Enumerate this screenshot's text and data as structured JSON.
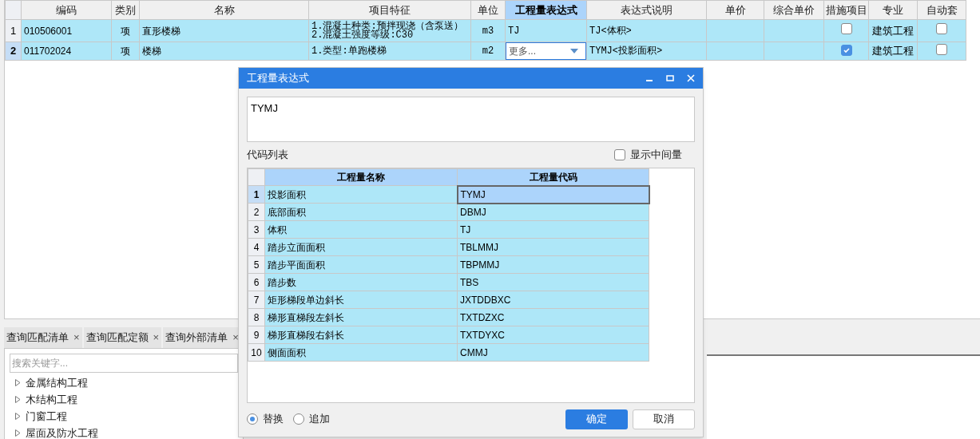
{
  "table": {
    "columns": [
      {
        "label": "编码",
        "selected": false
      },
      {
        "label": "类别",
        "selected": false
      },
      {
        "label": "名称",
        "selected": false
      },
      {
        "label": "项目特征",
        "selected": false
      },
      {
        "label": "单位",
        "selected": false
      },
      {
        "label": "工程量表达式",
        "selected": true
      },
      {
        "label": "表达式说明",
        "selected": false
      },
      {
        "label": "单价",
        "selected": false
      },
      {
        "label": "综合单价",
        "selected": false
      },
      {
        "label": "措施项目",
        "selected": false
      },
      {
        "label": "专业",
        "selected": false
      },
      {
        "label": "自动套",
        "selected": false
      }
    ],
    "rows": [
      {
        "number": "1",
        "selected": false,
        "code": "010506001",
        "type": "项",
        "name": "直形楼梯",
        "features": [
          "1.混凝土种类:预拌现浇（含泵送）",
          "2.混凝土强度等级:C30"
        ],
        "unit": "m3",
        "expression": {
          "kind": "text",
          "value": "TJ"
        },
        "description": "TJ<体积>",
        "measure_checked": false,
        "specialty": "建筑工程",
        "auto_checked": false
      },
      {
        "number": "2",
        "selected": true,
        "code": "011702024",
        "type": "项",
        "name": "楼梯",
        "features": [
          "1.类型:单跑楼梯"
        ],
        "unit": "m2",
        "expression": {
          "kind": "dropdown",
          "value": "更多..."
        },
        "description": "TYMJ<投影面积>",
        "measure_checked": true,
        "specialty": "建筑工程",
        "auto_checked": false
      }
    ]
  },
  "bottom_panel": {
    "tabs": [
      {
        "label": "查询匹配清单",
        "close": "×"
      },
      {
        "label": "查询匹配定额",
        "close": "×"
      },
      {
        "label": "查询外部清单",
        "close": "×"
      }
    ],
    "search": {
      "placeholder": "搜索关键字..."
    },
    "tree": [
      {
        "label": "金属结构工程",
        "expanded": false
      },
      {
        "label": "木结构工程",
        "expanded": false
      },
      {
        "label": "门窗工程",
        "expanded": false
      },
      {
        "label": "屋面及防水工程",
        "expanded": false
      }
    ]
  },
  "dialog": {
    "title": "工程量表达式",
    "expression": "TYMJ",
    "list_label": "代码列表",
    "show_intermediate": {
      "label": "显示中间量",
      "checked": false
    },
    "columns": [
      "工程量名称",
      "工程量代码"
    ],
    "rows": [
      {
        "number": "1",
        "name": "投影面积",
        "code": "TYMJ",
        "selected": true
      },
      {
        "number": "2",
        "name": "底部面积",
        "code": "DBMJ",
        "selected": false
      },
      {
        "number": "3",
        "name": "体积",
        "code": "TJ",
        "selected": false
      },
      {
        "number": "4",
        "name": "踏步立面面积",
        "code": "TBLMMJ",
        "selected": false
      },
      {
        "number": "5",
        "name": "踏步平面面积",
        "code": "TBPMMJ",
        "selected": false
      },
      {
        "number": "6",
        "name": "踏步数",
        "code": "TBS",
        "selected": false
      },
      {
        "number": "7",
        "name": "矩形梯段单边斜长",
        "code": "JXTDDBXC",
        "selected": false
      },
      {
        "number": "8",
        "name": "梯形直梯段左斜长",
        "code": "TXTDZXC",
        "selected": false
      },
      {
        "number": "9",
        "name": "梯形直梯段右斜长",
        "code": "TXTDYXC",
        "selected": false
      },
      {
        "number": "10",
        "name": "侧面面积",
        "code": "CMMJ",
        "selected": false
      }
    ],
    "modes": [
      {
        "label": "替换",
        "selected": true
      },
      {
        "label": "追加",
        "selected": false
      }
    ],
    "buttons": [
      {
        "label": "确定",
        "kind": "primary"
      },
      {
        "label": "取消",
        "kind": "default"
      }
    ]
  }
}
